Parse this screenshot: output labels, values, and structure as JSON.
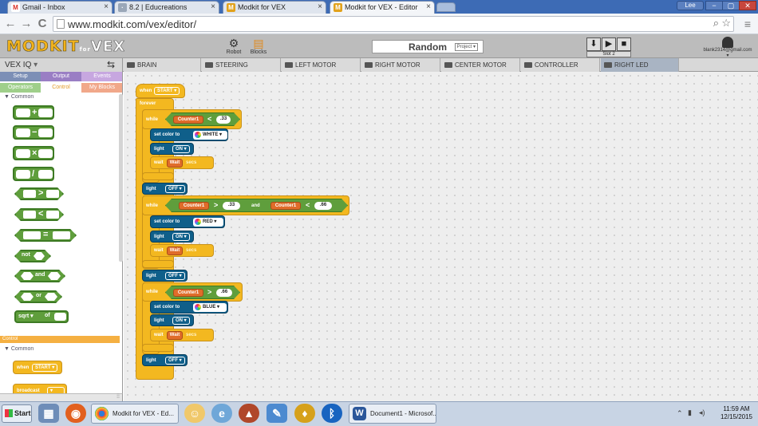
{
  "browser": {
    "tabs": [
      {
        "label": "Gmail - Inbox",
        "icon": "gmail-icon",
        "icon_color": "#d93025",
        "glyph": "M"
      },
      {
        "label": "8.2 | Educreations",
        "icon": "educreations-icon",
        "icon_color": "#9aa7b8",
        "glyph": "·"
      },
      {
        "label": "Modkit for VEX",
        "icon": "modkit-icon",
        "icon_color": "#e2a21b",
        "glyph": "M"
      },
      {
        "label": "Modkit for VEX - Editor",
        "icon": "modkit-icon",
        "icon_color": "#e2a21b",
        "glyph": "M"
      }
    ],
    "profile_name": "Lee",
    "window_min": "−",
    "window_max": "▢",
    "window_close": "✕",
    "back_glyph": "←",
    "forward_glyph": "→",
    "reload_glyph": "C",
    "url": "www.modkit.com/vex/editor/",
    "zoom_glyph": "⌕",
    "star_glyph": "☆",
    "menu_glyph": "≡"
  },
  "modkit": {
    "logo_main": "MODKIT",
    "logo_for": "for",
    "logo_vex": "VEX",
    "robot_label": "Robot",
    "blocks_label": "Blocks",
    "project_name": "Random",
    "project_badge": "Project ▾",
    "download_glyph": "⬇",
    "play_glyph": "▶",
    "stop_glyph": "■",
    "slot_label": "Slot 2",
    "user_email": "blank2314@gmail.com ▾",
    "device_select": "VEX IQ",
    "device_select_arrow": "▾",
    "swap_glyph": "⇆",
    "device_tabs": [
      "BRAIN",
      "STEERING",
      "LEFT MOTOR",
      "RIGHT MOTOR",
      "CENTER MOTOR",
      "CONTROLLER",
      "RIGHT LED"
    ]
  },
  "palette": {
    "tabs": [
      "Setup",
      "Output",
      "Events"
    ],
    "subtabs": [
      "Operators",
      "Control",
      "My Blocks"
    ],
    "common_heading": "▼ Common",
    "control_bar": "Control",
    "control_common": "▼ Common",
    "operators": [
      "+",
      "−",
      "×",
      "/",
      ">",
      "<",
      "=",
      "not",
      "and",
      "or"
    ],
    "sqrt_label": "sqrt ▾",
    "of_label": "of",
    "when_label": "when",
    "start_label": "START ▾",
    "broadcast_label": "broadcast",
    "broadcast_arrow": "▾"
  },
  "program": {
    "when_label": "when",
    "start_option": "START ▾",
    "forever_label": "forever",
    "while_label": "while",
    "and_label": "and",
    "set_color_label": "set color to",
    "light_label": "light",
    "wait_label": "wait",
    "wait_var": "Wait",
    "secs_label": "secs",
    "counter_var": "Counter1",
    "lt": "<",
    "gt": ">",
    "v033": ".33",
    "v066": ".66",
    "on_option": "ON ▾",
    "off_option": "OFF ▾",
    "white_option": "WHITE ▾",
    "red_option": "RED ▾",
    "blue_option": "BLUE ▾"
  },
  "taskbar": {
    "start_label": "Start",
    "apps": [
      {
        "label": "Modkit for VEX - Ed...",
        "icon": "chrome-icon",
        "color": "#2f7bd8"
      },
      {
        "label": "Document1 - Microsof...",
        "icon": "word-icon",
        "color": "#2b579a"
      }
    ],
    "tray_glyph": "⌃",
    "tray_glyph2": "▮",
    "tray_glyph3": "◂)",
    "time": "11:59 AM",
    "date": "12/15/2015"
  }
}
